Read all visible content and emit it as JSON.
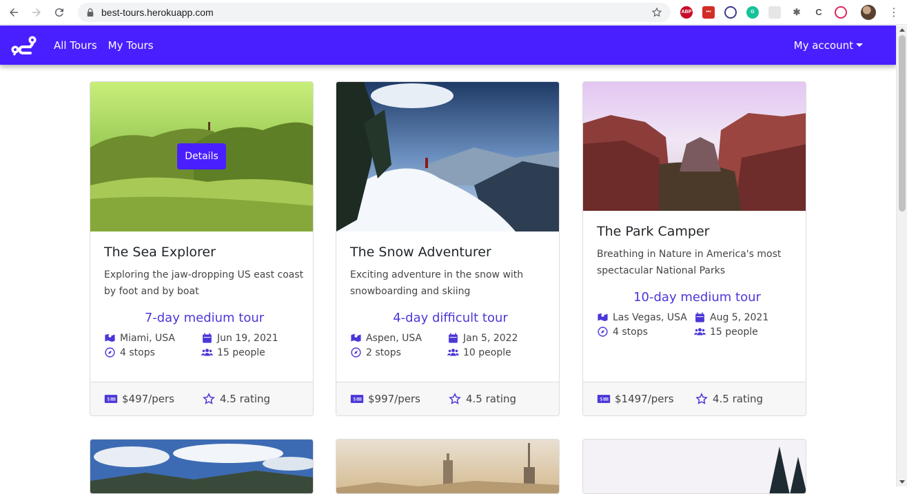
{
  "browser": {
    "url": "best-tours.herokuapp.com",
    "ext_abp": "ABP"
  },
  "nav": {
    "links": [
      "All Tours",
      "My Tours"
    ],
    "account": "My account"
  },
  "colors": {
    "primary": "#4a1fff",
    "accent_text": "#4a37d8"
  },
  "tours": [
    {
      "title": "The Sea Explorer",
      "description": "Exploring the jaw-dropping US east coast by foot and by boat",
      "summary": "7-day medium tour",
      "location": "Miami, USA",
      "date": "Jun 19, 2021",
      "stops": "4 stops",
      "people": "15 people",
      "price": "$497/pers",
      "rating": "4.5 rating",
      "details_label": "Details"
    },
    {
      "title": "The Snow Adventurer",
      "description": "Exciting adventure in the snow with snowboarding and skiing",
      "summary": "4-day difficult tour",
      "location": "Aspen, USA",
      "date": "Jan 5, 2022",
      "stops": "2 stops",
      "people": "10 people",
      "price": "$997/pers",
      "rating": "4.5 rating"
    },
    {
      "title": "The Park Camper",
      "description": "Breathing in Nature in America's most spectacular National Parks",
      "summary": "10-day medium tour",
      "location": "Las Vegas, USA",
      "date": "Aug 5, 2021",
      "stops": "4 stops",
      "people": "15 people",
      "price": "$1497/pers",
      "rating": "4.5 rating"
    }
  ]
}
